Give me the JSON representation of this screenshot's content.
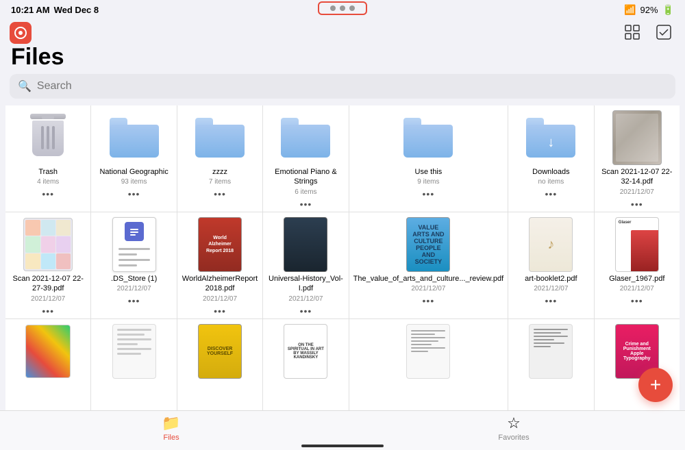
{
  "statusBar": {
    "time": "10:21 AM",
    "date": "Wed Dec 8",
    "battery": "92%",
    "wifiIcon": "wifi"
  },
  "header": {
    "title": "Files",
    "searchPlaceholder": "Search"
  },
  "topBar": {
    "dotsLabel": "···"
  },
  "topRightIcons": {
    "gridIcon": "grid",
    "checkIcon": "check-square"
  },
  "grid": {
    "rows": [
      [
        {
          "id": "trash",
          "type": "trash",
          "name": "Trash",
          "sub": "4 items"
        },
        {
          "id": "national-geographic",
          "type": "folder",
          "name": "National Geographic",
          "sub": "93 items"
        },
        {
          "id": "zzzz",
          "type": "folder",
          "name": "zzzz",
          "sub": "7 items"
        },
        {
          "id": "emotional-piano",
          "type": "folder",
          "name": "Emotional Piano & Strings",
          "sub": "6 items"
        },
        {
          "id": "use-this",
          "type": "folder",
          "name": "Use this",
          "sub": "9 items"
        },
        {
          "id": "downloads",
          "type": "folder-download",
          "name": "Downloads",
          "sub": "no items"
        },
        {
          "id": "scan1",
          "type": "photo",
          "name": "Scan 2021-12-07 22-32-14.pdf",
          "sub": "2021/12/07"
        }
      ],
      [
        {
          "id": "scan2",
          "type": "photo2",
          "name": "Scan 2021-12-07 22-27-39.pdf",
          "sub": "2021/12/07"
        },
        {
          "id": "ds-store",
          "type": "doc",
          "name": ".DS_Store (1)",
          "sub": "2021/12/07"
        },
        {
          "id": "world-alzheimer",
          "type": "book-red",
          "name": "WorldAlzheimerReport 2018.pdf",
          "sub": "2021/12/07"
        },
        {
          "id": "universal-history",
          "type": "book-black",
          "name": "Universal-History_Vol-I.pdf",
          "sub": "2021/12/07"
        },
        {
          "id": "value-arts",
          "type": "book-teal",
          "name": "The_value_of_arts_and_culture..._review.pdf",
          "sub": "2021/12/07"
        },
        {
          "id": "art-booklet",
          "type": "art-beige",
          "name": "art-booklet2.pdf",
          "sub": "2021/12/07"
        },
        {
          "id": "glaser",
          "type": "book-glaser",
          "name": "Glaser_1967.pdf",
          "sub": "2021/12/07"
        }
      ],
      [
        {
          "id": "row3-1",
          "type": "row3-colorful1",
          "name": "",
          "sub": ""
        },
        {
          "id": "row3-2",
          "type": "row3-white",
          "name": "",
          "sub": ""
        },
        {
          "id": "row3-3",
          "type": "row3-yellow",
          "name": "",
          "sub": ""
        },
        {
          "id": "row3-4",
          "type": "row3-kandinsky",
          "name": "",
          "sub": ""
        },
        {
          "id": "row3-5",
          "type": "row3-plain",
          "name": "",
          "sub": ""
        },
        {
          "id": "row3-6",
          "type": "row3-text",
          "name": "",
          "sub": ""
        },
        {
          "id": "row3-7",
          "type": "row3-crime",
          "name": "",
          "sub": ""
        }
      ]
    ]
  },
  "tabBar": {
    "tabs": [
      {
        "id": "files",
        "label": "Files",
        "icon": "📁",
        "active": true
      },
      {
        "id": "favorites",
        "label": "Favorites",
        "icon": "☆",
        "active": false
      }
    ]
  },
  "fab": {
    "label": "+"
  }
}
